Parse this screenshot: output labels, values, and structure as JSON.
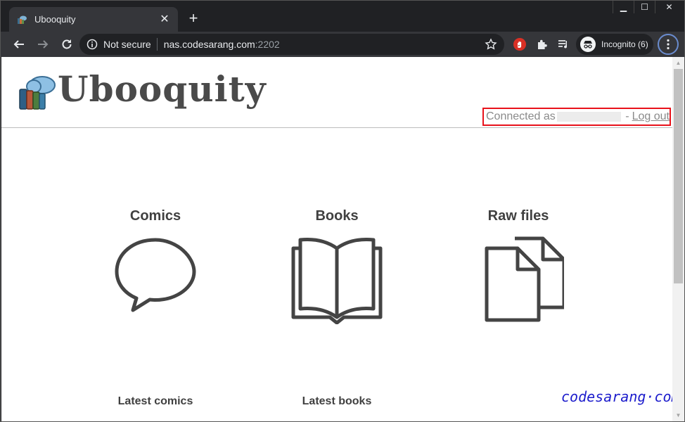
{
  "browser": {
    "tab_title": "Ubooquity",
    "tab_close": "✕",
    "new_tab": "+",
    "window_controls": {
      "minimize": "▁",
      "maximize": "☐",
      "close": "✕"
    },
    "omnibox": {
      "security_label": "Not secure",
      "host": "nas.codesarang.com",
      "port": ":2202"
    },
    "profile_label": "Incognito (6)",
    "accent_color": "#6a8ccf"
  },
  "site": {
    "logo_text": "Ubooquity",
    "connected_prefix": "Connected as",
    "separator": "-",
    "logout_label": "Log out",
    "highlight_color": "#e8121b",
    "sections": [
      {
        "title": "Comics",
        "icon": "speech-bubble-icon"
      },
      {
        "title": "Books",
        "icon": "open-book-icon"
      },
      {
        "title": "Raw files",
        "icon": "files-icon"
      }
    ],
    "latest": {
      "comics": "Latest comics",
      "books": "Latest books"
    },
    "watermark": "codesarang·com",
    "watermark_color": "#1c1ccc"
  }
}
